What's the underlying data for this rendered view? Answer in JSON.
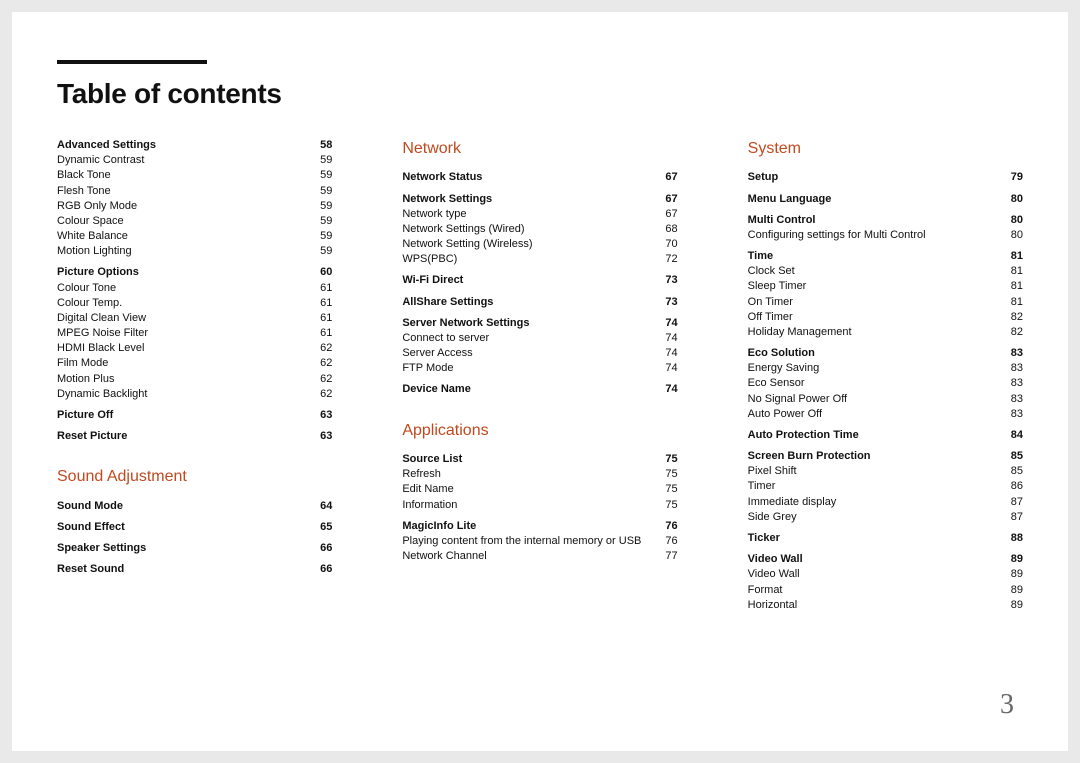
{
  "page": {
    "title": "Table of contents",
    "number": "3"
  },
  "columns": [
    {
      "chapters": [
        {
          "title": null,
          "groups": [
            {
              "heading": {
                "label": "Advanced Settings",
                "page": "58"
              },
              "items": [
                {
                  "label": "Dynamic Contrast",
                  "page": "59"
                },
                {
                  "label": "Black Tone",
                  "page": "59"
                },
                {
                  "label": "Flesh Tone",
                  "page": "59"
                },
                {
                  "label": "RGB Only Mode",
                  "page": "59"
                },
                {
                  "label": "Colour Space",
                  "page": "59"
                },
                {
                  "label": "White Balance",
                  "page": "59"
                },
                {
                  "label": "Motion Lighting",
                  "page": "59"
                }
              ]
            },
            {
              "heading": {
                "label": "Picture Options",
                "page": "60"
              },
              "items": [
                {
                  "label": "Colour Tone",
                  "page": "61"
                },
                {
                  "label": "Colour Temp.",
                  "page": "61"
                },
                {
                  "label": "Digital Clean View",
                  "page": "61"
                },
                {
                  "label": "MPEG Noise Filter",
                  "page": "61"
                },
                {
                  "label": "HDMI Black Level",
                  "page": "62"
                },
                {
                  "label": "Film Mode",
                  "page": "62"
                },
                {
                  "label": "Motion Plus",
                  "page": "62"
                },
                {
                  "label": "Dynamic Backlight",
                  "page": "62"
                }
              ]
            },
            {
              "heading": {
                "label": "Picture Off",
                "page": "63"
              },
              "items": []
            },
            {
              "heading": {
                "label": "Reset Picture",
                "page": "63"
              },
              "items": []
            }
          ]
        },
        {
          "title": "Sound Adjustment",
          "groups": [
            {
              "heading": {
                "label": "Sound Mode",
                "page": "64"
              },
              "items": []
            },
            {
              "heading": {
                "label": "Sound Effect",
                "page": "65"
              },
              "items": []
            },
            {
              "heading": {
                "label": "Speaker Settings",
                "page": "66"
              },
              "items": []
            },
            {
              "heading": {
                "label": "Reset Sound",
                "page": "66"
              },
              "items": []
            }
          ]
        }
      ]
    },
    {
      "chapters": [
        {
          "title": "Network",
          "groups": [
            {
              "heading": {
                "label": "Network Status",
                "page": "67"
              },
              "items": []
            },
            {
              "heading": {
                "label": "Network Settings",
                "page": "67"
              },
              "items": [
                {
                  "label": "Network type",
                  "page": "67"
                },
                {
                  "label": "Network Settings (Wired)",
                  "page": "68"
                },
                {
                  "label": "Network Setting (Wireless)",
                  "page": "70"
                },
                {
                  "label": "WPS(PBC)",
                  "page": "72"
                }
              ]
            },
            {
              "heading": {
                "label": "Wi-Fi Direct",
                "page": "73"
              },
              "items": []
            },
            {
              "heading": {
                "label": "AllShare Settings",
                "page": "73"
              },
              "items": []
            },
            {
              "heading": {
                "label": "Server Network Settings",
                "page": "74"
              },
              "items": [
                {
                  "label": "Connect to server",
                  "page": "74"
                },
                {
                  "label": "Server Access",
                  "page": "74"
                },
                {
                  "label": "FTP Mode",
                  "page": "74"
                }
              ]
            },
            {
              "heading": {
                "label": "Device Name",
                "page": "74"
              },
              "items": []
            }
          ]
        },
        {
          "title": "Applications",
          "groups": [
            {
              "heading": {
                "label": "Source List",
                "page": "75"
              },
              "items": [
                {
                  "label": "Refresh",
                  "page": "75"
                },
                {
                  "label": "Edit Name",
                  "page": "75"
                },
                {
                  "label": "Information",
                  "page": "75"
                }
              ]
            },
            {
              "heading": {
                "label": "MagicInfo Lite",
                "page": "76"
              },
              "items": [
                {
                  "label": "Playing content from the internal memory or USB",
                  "page": "76"
                },
                {
                  "label": "Network Channel",
                  "page": "77"
                }
              ]
            }
          ]
        }
      ]
    },
    {
      "chapters": [
        {
          "title": "System",
          "groups": [
            {
              "heading": {
                "label": "Setup",
                "page": "79"
              },
              "items": []
            },
            {
              "heading": {
                "label": "Menu Language",
                "page": "80"
              },
              "items": []
            },
            {
              "heading": {
                "label": "Multi Control",
                "page": "80"
              },
              "items": [
                {
                  "label": "Configuring settings for Multi Control",
                  "page": "80"
                }
              ]
            },
            {
              "heading": {
                "label": "Time",
                "page": "81"
              },
              "items": [
                {
                  "label": "Clock Set",
                  "page": "81"
                },
                {
                  "label": "Sleep Timer",
                  "page": "81"
                },
                {
                  "label": "On Timer",
                  "page": "81"
                },
                {
                  "label": "Off Timer",
                  "page": "82"
                },
                {
                  "label": "Holiday Management",
                  "page": "82"
                }
              ]
            },
            {
              "heading": {
                "label": "Eco Solution",
                "page": "83"
              },
              "items": [
                {
                  "label": "Energy Saving",
                  "page": "83"
                },
                {
                  "label": "Eco Sensor",
                  "page": "83"
                },
                {
                  "label": "No Signal Power Off",
                  "page": "83"
                },
                {
                  "label": "Auto Power Off",
                  "page": "83"
                }
              ]
            },
            {
              "heading": {
                "label": "Auto Protection Time",
                "page": "84"
              },
              "items": []
            },
            {
              "heading": {
                "label": "Screen Burn Protection",
                "page": "85"
              },
              "items": [
                {
                  "label": "Pixel Shift",
                  "page": "85"
                },
                {
                  "label": "Timer",
                  "page": "86"
                },
                {
                  "label": "Immediate display",
                  "page": "87"
                },
                {
                  "label": "Side Grey",
                  "page": "87"
                }
              ]
            },
            {
              "heading": {
                "label": "Ticker",
                "page": "88"
              },
              "items": []
            },
            {
              "heading": {
                "label": "Video Wall",
                "page": "89"
              },
              "items": [
                {
                  "label": "Video Wall",
                  "page": "89"
                },
                {
                  "label": "Format",
                  "page": "89"
                },
                {
                  "label": "Horizontal",
                  "page": "89"
                }
              ]
            }
          ]
        }
      ]
    }
  ]
}
